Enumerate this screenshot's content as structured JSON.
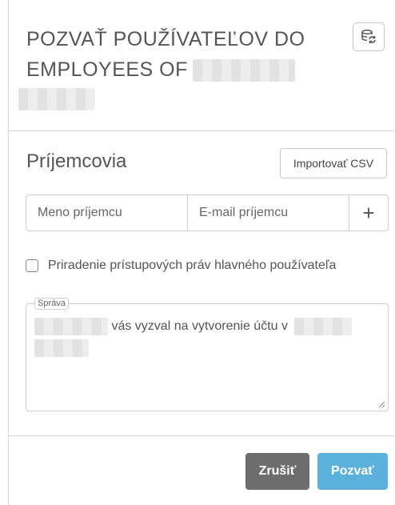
{
  "dialog": {
    "title_line1": "POZVAŤ POUŽÍVATEĽOV DO",
    "title_line2": "EMPLOYEES OF",
    "refresh_icon": "refresh-users-icon"
  },
  "recipients": {
    "label": "Príjemcovia",
    "import_label": "Importovať CSV",
    "name_placeholder": "Meno príjemcu",
    "email_placeholder": "E-mail príjemcu",
    "add_symbol": "+"
  },
  "permissions": {
    "checkbox_label": "Priradenie prístupových práv hlavného používateľa",
    "checked": false
  },
  "message": {
    "legend": "Správa",
    "text": "vás vyzval na vytvorenie účtu v"
  },
  "footer": {
    "cancel_label": "Zrušiť",
    "invite_label": "Pozvať"
  },
  "colors": {
    "invite_button": "#5bb1dc",
    "cancel_button": "#6d6d6d"
  }
}
